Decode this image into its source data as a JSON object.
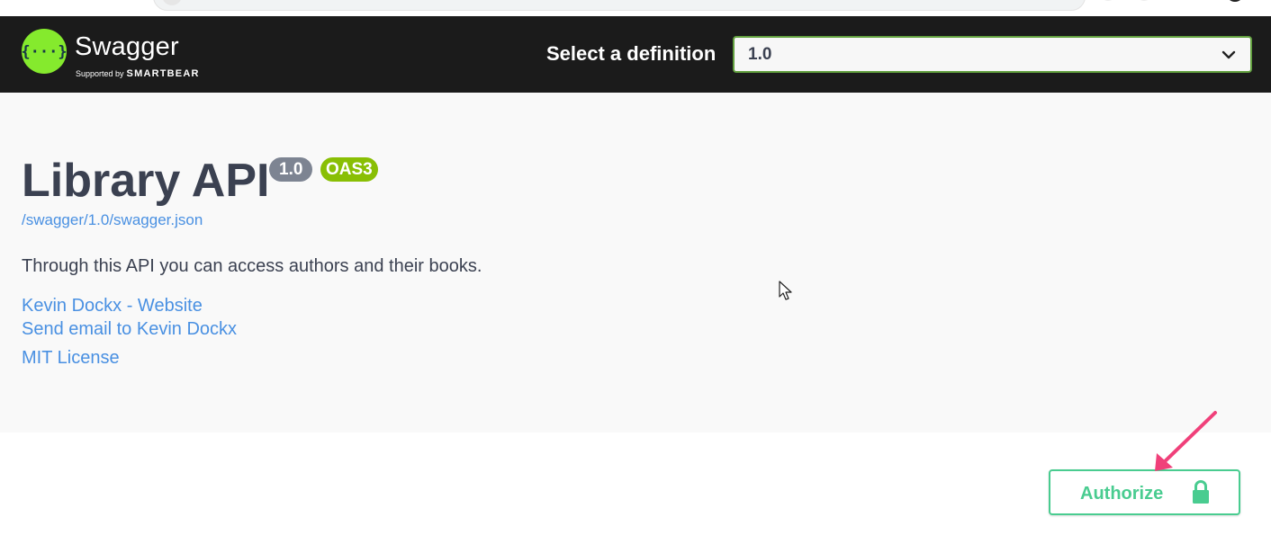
{
  "header": {
    "brand_name": "Swagger",
    "brand_supported_by": "Supported by",
    "brand_company": "SMARTBEAR",
    "select_label": "Select a definition",
    "selected_definition": "1.0"
  },
  "info": {
    "title": "Library API",
    "version_badge": "1.0",
    "oas_badge": "OAS3",
    "spec_url": "/swagger/1.0/swagger.json",
    "description": "Through this API you can access authors and their books.",
    "contact_website": "Kevin Dockx - Website",
    "contact_email": "Send email to Kevin Dockx",
    "license": "MIT License"
  },
  "scheme_container": {
    "authorize_label": "Authorize"
  },
  "colors": {
    "topbar_bg": "#1b1b1b",
    "swagger_green": "#85ea2d",
    "select_border": "#62a03f",
    "title_text": "#3b4151",
    "link_blue": "#4990e2",
    "version_badge": "#7d8492",
    "oas_badge": "#89bf04",
    "authorize_green": "#49cc90",
    "annotation_arrow": "#f0407a"
  },
  "icons": {
    "logo": "swagger-logo-icon",
    "dropdown": "chevron-down-icon",
    "authorize": "lock-icon",
    "cursor": "mouse-cursor-icon",
    "annotation": "arrow-annotation-icon"
  }
}
